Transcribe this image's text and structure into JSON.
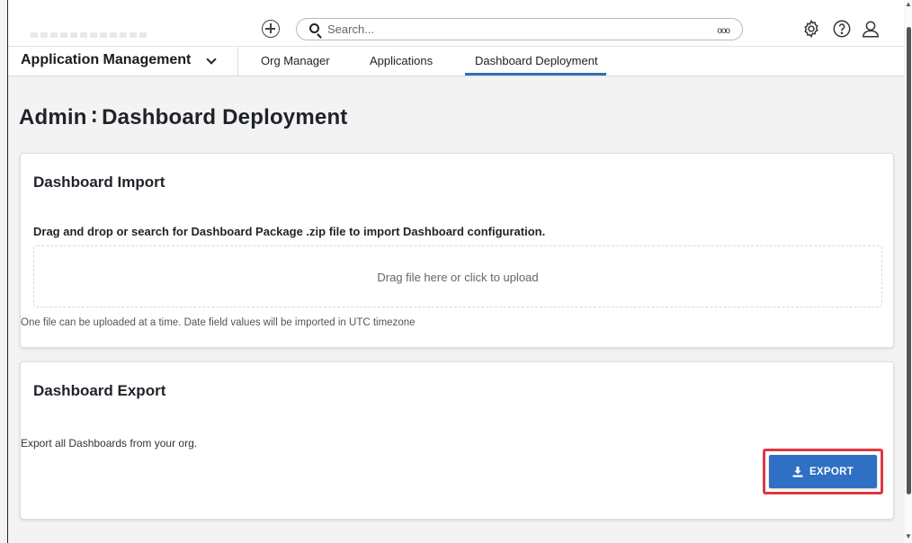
{
  "topbar": {
    "search_placeholder": "Search...",
    "more_label": "ooo"
  },
  "nav": {
    "app_switcher_label": "Application Management",
    "tabs": [
      {
        "label": "Org Manager"
      },
      {
        "label": "Applications"
      },
      {
        "label": "Dashboard Deployment",
        "active": true
      }
    ]
  },
  "page": {
    "title": "Admin ∶ Dashboard Deployment"
  },
  "import_card": {
    "title": "Dashboard Import",
    "instructions": "Drag and drop or search for Dashboard Package .zip file to import Dashboard configuration.",
    "dropzone_text": "Drag file here or click to upload",
    "note": "One file can be uploaded at a time. Date field values will be imported in UTC timezone"
  },
  "export_card": {
    "title": "Dashboard Export",
    "description": "Export all Dashboards from your org.",
    "button_label": "EXPORT"
  },
  "colors": {
    "accent": "#2f6fb3",
    "export_button": "#2f6fc4",
    "highlight": "#e0373f"
  },
  "icons": [
    "add-icon",
    "search-icon",
    "more-icon",
    "gear-icon",
    "help-icon",
    "user-icon",
    "chevron-down-icon",
    "download-icon"
  ]
}
